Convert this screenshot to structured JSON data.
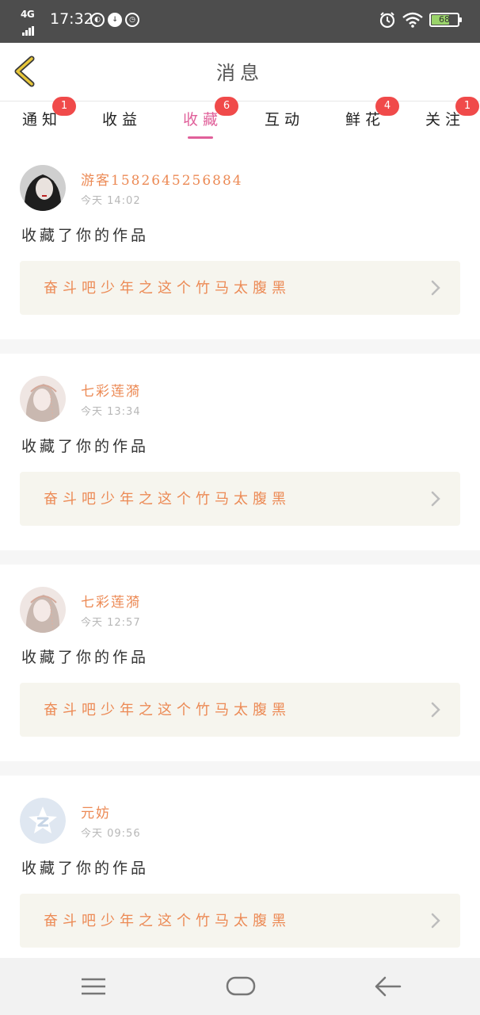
{
  "status_bar": {
    "network": "4G",
    "time": "17:32",
    "battery": "68",
    "battery_level": 0.68
  },
  "header": {
    "title": "消息"
  },
  "tabs": [
    {
      "label": "通知",
      "badge": "1",
      "active": false
    },
    {
      "label": "收益",
      "badge": "",
      "active": false
    },
    {
      "label": "收藏",
      "badge": "6",
      "active": true
    },
    {
      "label": "互动",
      "badge": "",
      "active": false
    },
    {
      "label": "鲜花",
      "badge": "4",
      "active": false
    },
    {
      "label": "关注",
      "badge": "1",
      "active": false
    }
  ],
  "feed": [
    {
      "username": "游客1582645256884",
      "time": "今天 14:02",
      "action": "收藏了你的作品",
      "work_title": "奋斗吧少年之这个竹马太腹黑",
      "avatar": "dark-hair-portrait"
    },
    {
      "username": "七彩莲漪",
      "time": "今天 13:34",
      "action": "收藏了你的作品",
      "work_title": "奋斗吧少年之这个竹马太腹黑",
      "avatar": "veiled-portrait"
    },
    {
      "username": "七彩莲漪",
      "time": "今天 12:57",
      "action": "收藏了你的作品",
      "work_title": "奋斗吧少年之这个竹马太腹黑",
      "avatar": "veiled-portrait"
    },
    {
      "username": "元妨",
      "time": "今天 09:56",
      "action": "收藏了你的作品",
      "work_title": "奋斗吧少年之这个竹马太腹黑",
      "avatar": "qq-default-avatar"
    }
  ],
  "colors": {
    "accent": "#e0609a",
    "username": "#ec8a55",
    "badge": "#f04a4a",
    "status_bar": "#4d4d4d",
    "work_box": "#f6f5ee"
  },
  "icons": {
    "back": "chevron-left-icon",
    "menu": "menu-icon",
    "home": "home-icon",
    "back_nav": "back-arrow-icon"
  }
}
